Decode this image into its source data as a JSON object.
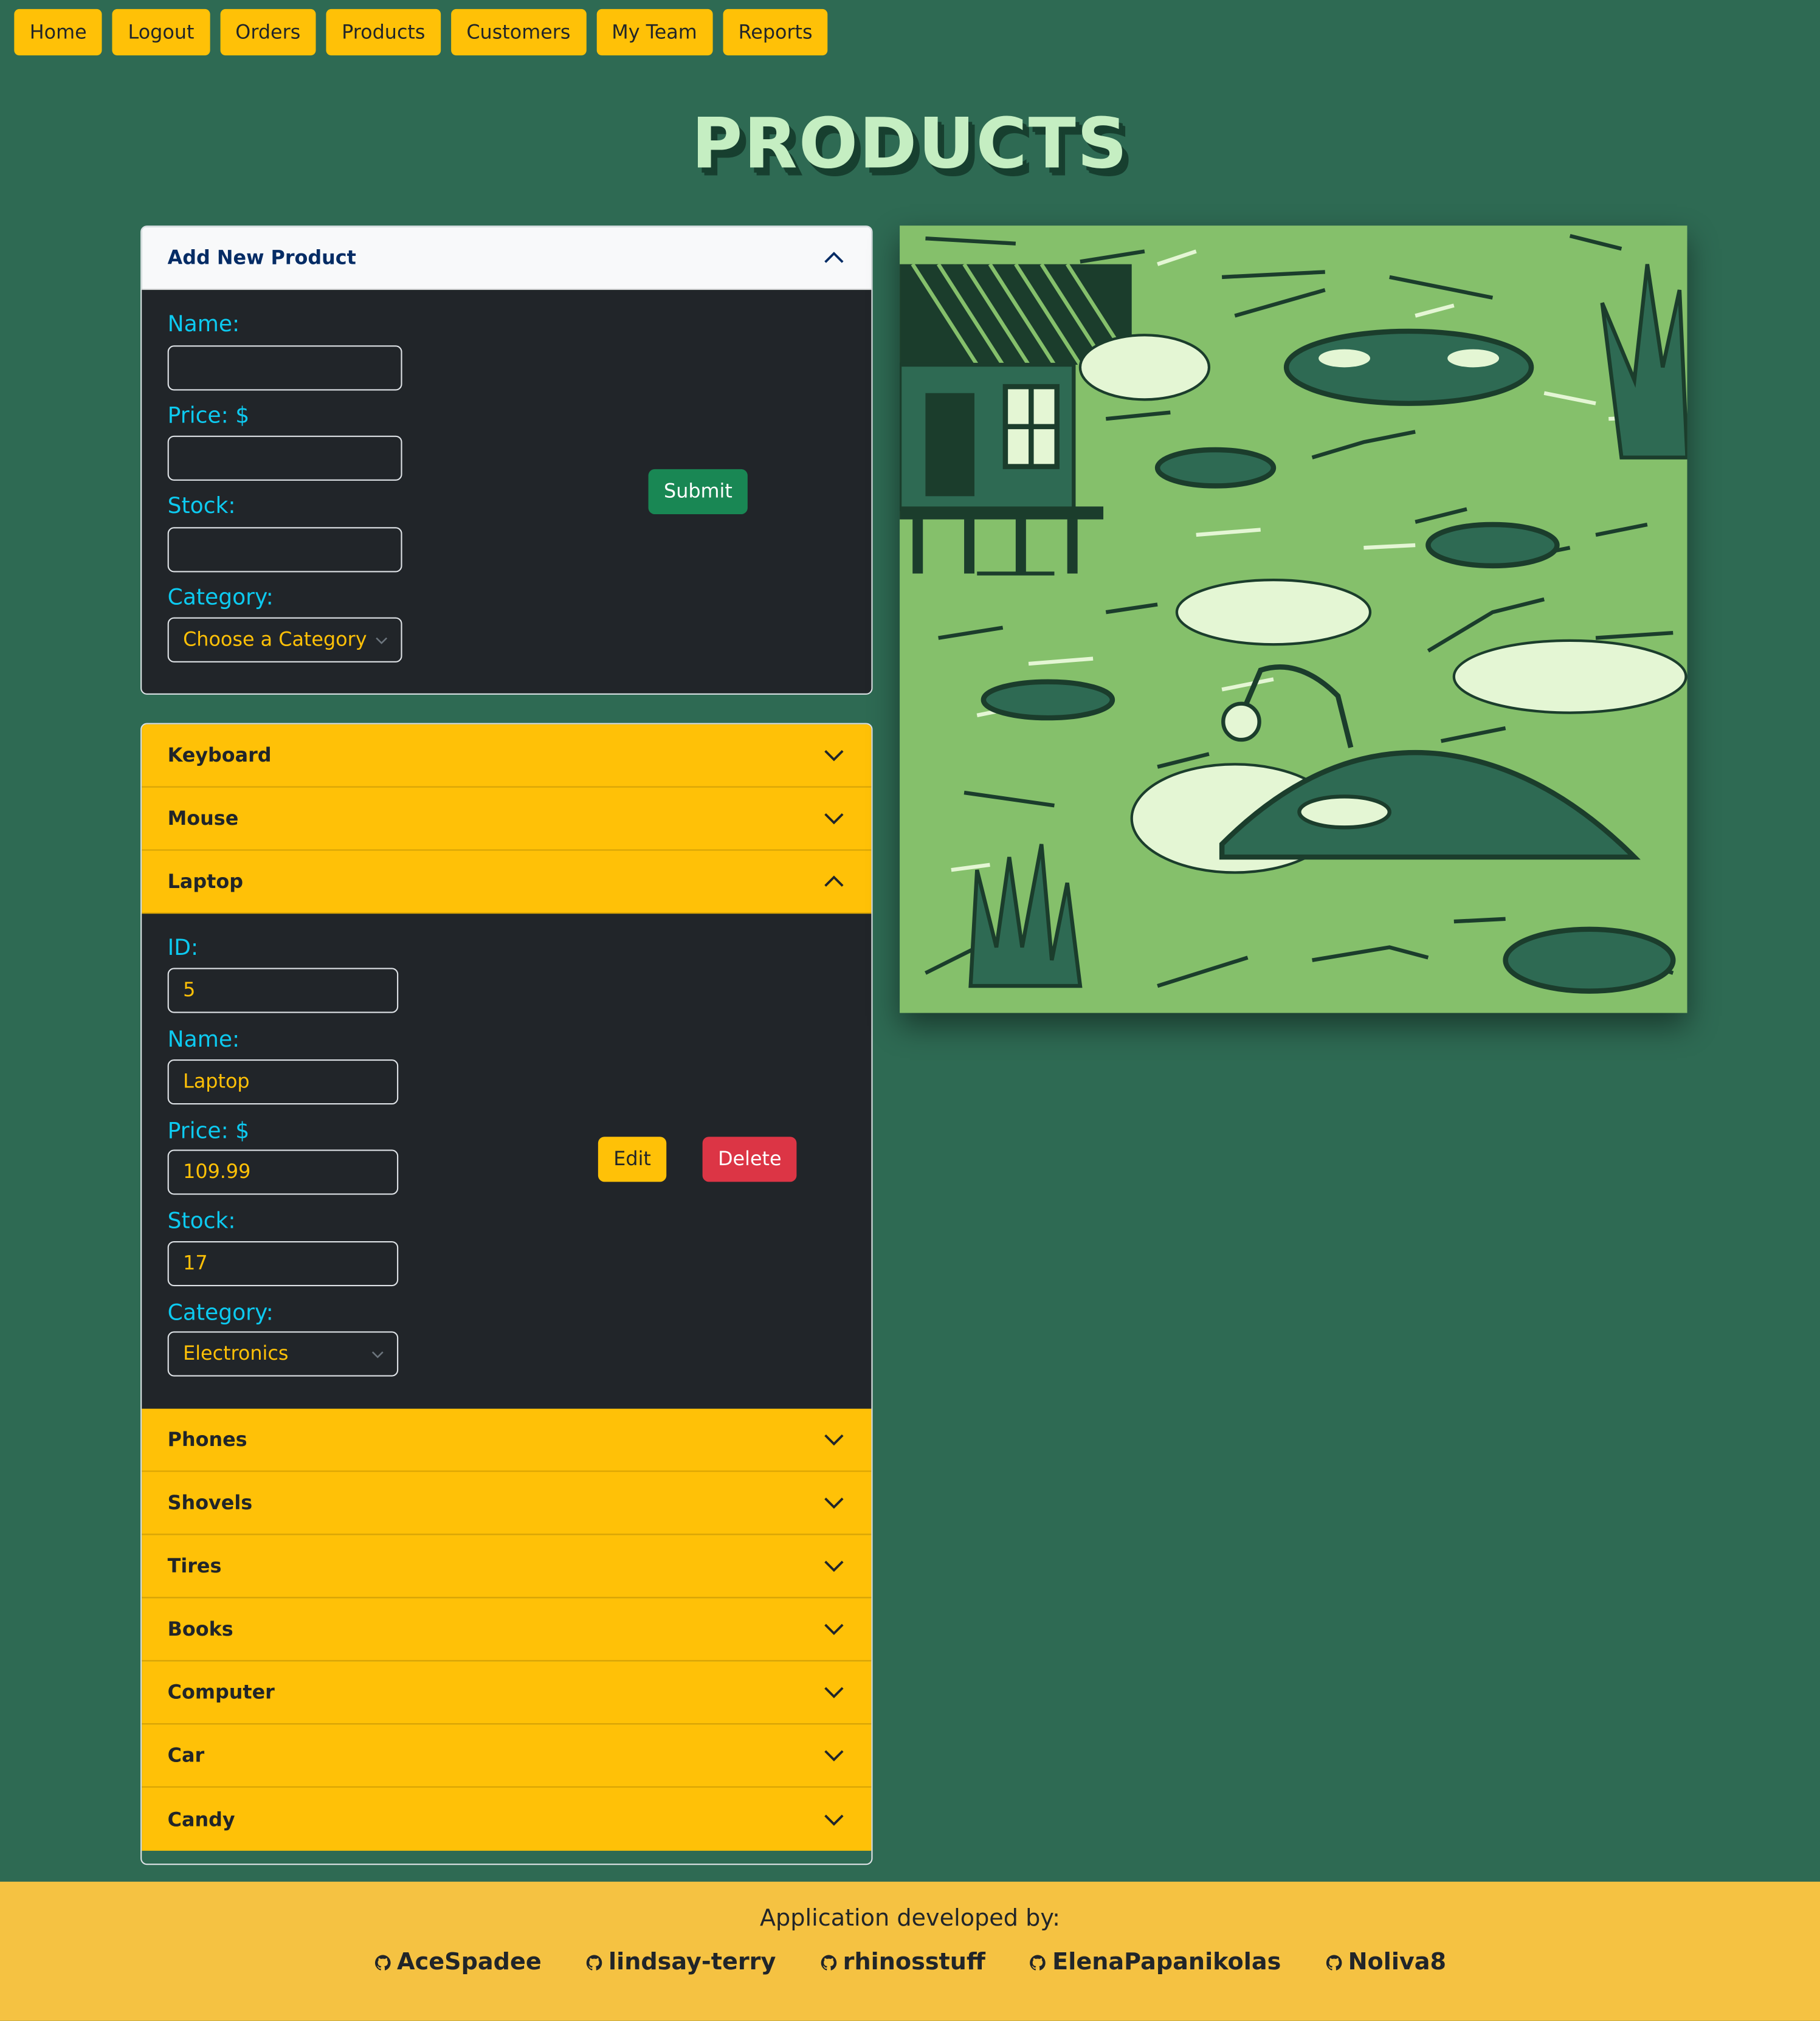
{
  "nav": [
    "Home",
    "Logout",
    "Orders",
    "Products",
    "Customers",
    "My Team",
    "Reports"
  ],
  "page_title": "PRODUCTS",
  "add_form": {
    "header": "Add New Product",
    "name_label": "Name:",
    "price_label": "Price: $",
    "stock_label": "Stock:",
    "category_label": "Category:",
    "category_placeholder": "Choose a Category",
    "submit_label": "Submit"
  },
  "products": [
    {
      "name": "Keyboard",
      "expanded": false
    },
    {
      "name": "Mouse",
      "expanded": false
    },
    {
      "name": "Laptop",
      "expanded": true
    },
    {
      "name": "Phones",
      "expanded": false
    },
    {
      "name": "Shovels",
      "expanded": false
    },
    {
      "name": "Tires",
      "expanded": false
    },
    {
      "name": "Books",
      "expanded": false
    },
    {
      "name": "Computer",
      "expanded": false
    },
    {
      "name": "Car",
      "expanded": false
    },
    {
      "name": "Candy",
      "expanded": false
    }
  ],
  "detail": {
    "id_label": "ID:",
    "id": "5",
    "name_label": "Name:",
    "name": "Laptop",
    "price_label": "Price: $",
    "price": "109.99",
    "stock_label": "Stock:",
    "stock": "17",
    "category_label": "Category:",
    "category": "Electronics",
    "edit_label": "Edit",
    "delete_label": "Delete"
  },
  "footer": {
    "text": "Application developed by:",
    "developers": [
      "AceSpadee",
      "lindsay-terry",
      "rhinosstuff",
      "ElenaPapanikolas",
      "Noliva8"
    ]
  },
  "colors": {
    "background": "#2e6a53",
    "accent": "#ffc107",
    "label": "#0dcaf0",
    "panel": "#212529",
    "success": "#198754",
    "danger": "#dc3545",
    "footer": "#f5c242"
  },
  "icons": {
    "accordion_toggle": "chevron-icon",
    "developer_link": "github-icon"
  }
}
